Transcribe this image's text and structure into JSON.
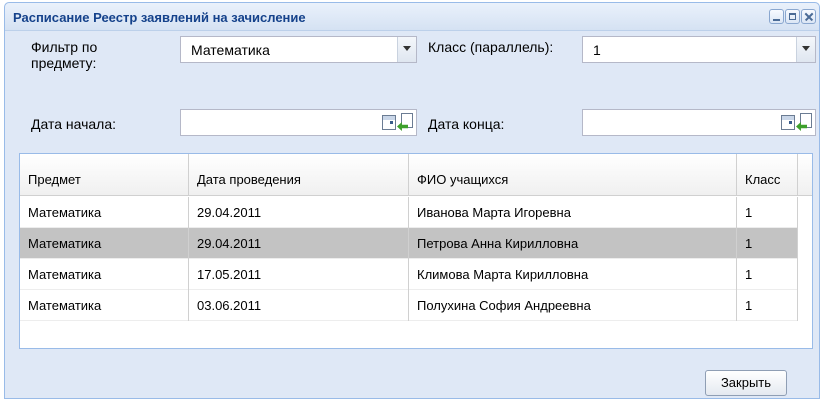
{
  "window": {
    "title": "Расписание Реестр заявлений на зачисление"
  },
  "filters": {
    "subject_label": "Фильтр по предмету:",
    "subject_value": "Математика",
    "class_label": "Класс (параллель):",
    "class_value": "1",
    "start_label": "Дата начала:",
    "start_value": "",
    "end_label": "Дата конца:",
    "end_value": ""
  },
  "grid": {
    "columns": [
      "Предмет",
      "Дата проведения",
      "ФИО учащихся",
      "Класс"
    ],
    "rows": [
      [
        "Математика",
        "29.04.2011",
        "Иванова Марта Игоревна",
        "1"
      ],
      [
        "Математика",
        "29.04.2011",
        "Петрова Анна Кирилловна",
        "1"
      ],
      [
        "Математика",
        "17.05.2011",
        "Климова Марта Кирилловна",
        "1"
      ],
      [
        "Математика",
        "03.06.2011",
        "Полухина София Андреевна",
        "1"
      ]
    ],
    "selected_row": 1
  },
  "footer": {
    "close_label": "Закрыть"
  }
}
